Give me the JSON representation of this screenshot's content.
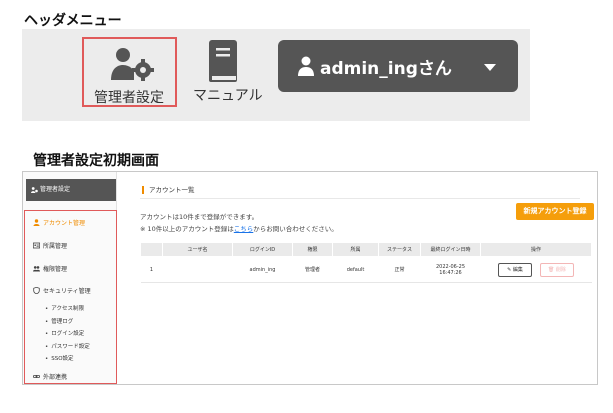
{
  "header_section": {
    "title": "ヘッダメニュー",
    "admin_settings_label": "管理者設定",
    "manual_label": "マニュアル",
    "user_label": "admin_ingさん"
  },
  "screen_section": {
    "title": "管理者設定初期画面"
  },
  "sidebar": {
    "head": "管理者設定",
    "items": [
      {
        "label": "アカウント管理",
        "icon": "person-icon",
        "active": true
      },
      {
        "label": "所属管理",
        "icon": "id-card-icon"
      },
      {
        "label": "権限管理",
        "icon": "users-icon"
      },
      {
        "label": "セキュリティ管理",
        "icon": "shield-icon"
      }
    ],
    "sub_items": [
      "アクセス制限",
      "管理ログ",
      "ログイン設定",
      "パスワード設定",
      "SSO設定"
    ],
    "external": {
      "label": "外部連携",
      "icon": "link-icon"
    }
  },
  "main": {
    "page_title": "アカウント一覧",
    "new_button": "新規アカウント登録",
    "info_line1": "アカウントは10件まで登録ができます。",
    "info_line2_prefix": "※ 10件以上のアカウント登録は",
    "info_line2_link": "こちら",
    "info_line2_suffix": "からお問い合わせください。",
    "table": {
      "headers": [
        "",
        "ユーザ名",
        "ログインID",
        "権限",
        "所属",
        "ステータス",
        "最終ログイン日時",
        "操作"
      ],
      "rows": [
        {
          "no": "1",
          "username": "",
          "login_id": "admin_ing",
          "role": "管理者",
          "dept": "default",
          "status": "正常",
          "last_login_date": "2022-06-25",
          "last_login_time": "16:47:26",
          "edit": "編集",
          "delete": "削除"
        }
      ]
    }
  },
  "colors": {
    "accent": "#f59e0b",
    "highlight": "#e05a5a",
    "dark": "#555555",
    "link": "#1a73e8"
  }
}
